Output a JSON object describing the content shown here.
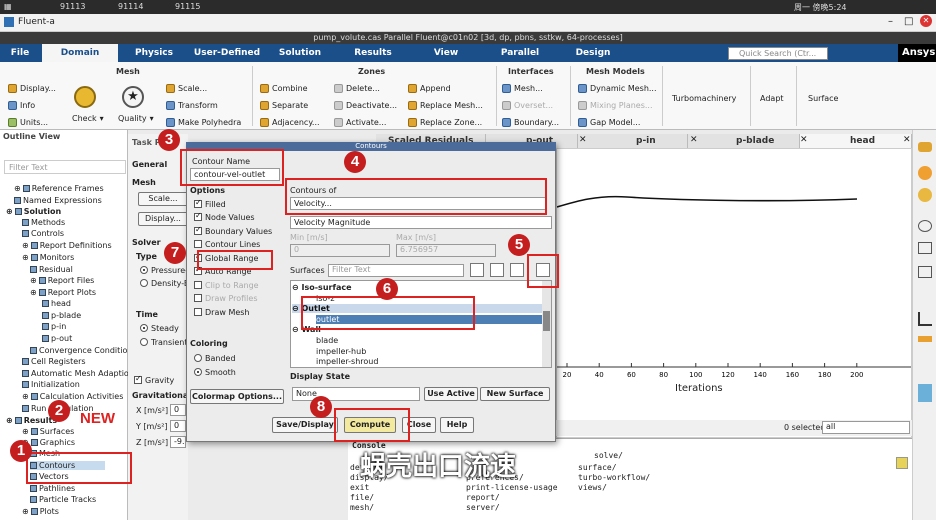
{
  "os_bar": {
    "items": [
      "91113",
      "91114",
      "91115"
    ],
    "clock": "周一 傍晚5:24"
  },
  "window": {
    "title": "Fluent-a",
    "app_title": "pump_volute.cas Parallel Fluent@c01n02  [3d, dp, pbns, sstkw, 64-processes]"
  },
  "ribbon_tabs": [
    "File",
    "Domain",
    "Physics",
    "User-Defined",
    "Solution",
    "Results",
    "View",
    "Parallel",
    "Design"
  ],
  "quick_search_placeholder": "Quick Search (Ctr...",
  "brand": "Ansys",
  "ribbon": {
    "groups": {
      "mesh": "Mesh",
      "zones": "Zones",
      "interfaces": "Interfaces",
      "mesh_models": "Mesh Models"
    },
    "mesh": {
      "display": "Display...",
      "info": "Info",
      "units": "Units...",
      "check": "Check",
      "quality": "Quality",
      "scale": "Scale...",
      "transform": "Transform",
      "polyhedra": "Make Polyhedra"
    },
    "zones": {
      "combine": "Combine",
      "separate": "Separate",
      "adjacency": "Adjacency...",
      "delete": "Delete...",
      "deactivate": "Deactivate...",
      "activate": "Activate...",
      "append": "Append",
      "replace_mesh": "Replace Mesh...",
      "replace_zone": "Replace Zone..."
    },
    "interfaces": {
      "mesh": "Mesh...",
      "overset": "Overset...",
      "boundary": "Boundary..."
    },
    "mesh_models": {
      "dynamic": "Dynamic Mesh...",
      "mixing": "Mixing Planes...",
      "gap": "Gap Model..."
    },
    "turbomachinery": "Turbomachinery",
    "adapt": "Adapt",
    "surface": "Surface"
  },
  "outline": {
    "header": "Outline View",
    "filter_placeholder": "Filter Text",
    "items": [
      "Reference Frames",
      "Named Expressions",
      "Solution",
      "Methods",
      "Controls",
      "Report Definitions",
      "Monitors",
      "Residual",
      "Report Files",
      "Report Plots",
      "head",
      "p-blade",
      "p-in",
      "p-out",
      "Convergence Conditions",
      "Cell Registers",
      "Automatic Mesh Adaption",
      "Initialization",
      "Calculation Activities",
      "Run Calculation",
      "Results",
      "Surfaces",
      "Graphics",
      "Mesh",
      "Contours",
      "Vectors",
      "Pathlines",
      "Particle Tracks",
      "Plots"
    ]
  },
  "task_page": {
    "title": "Task Page",
    "general": "General",
    "mesh": "Mesh",
    "scale": "Scale...",
    "display": "Display...",
    "solver": "Solver",
    "type": "Type",
    "pressure": "Pressure-Based",
    "density": "Density-Based",
    "time": "Time",
    "steady": "Steady",
    "transient": "Transient",
    "gravity": "Gravity",
    "gravitational": "Gravitational Acceleration",
    "x": "X [m/s²]",
    "y": "Y [m/s²]",
    "z": "Z [m/s²]",
    "x_val": "0",
    "y_val": "0",
    "z_val": "-9.81"
  },
  "graphics_tabs": [
    "Scaled Residuals",
    "p-out",
    "p-in",
    "p-blade",
    "head"
  ],
  "plot": {
    "x_ticks": [
      "20",
      "40",
      "60",
      "80",
      "100",
      "120",
      "140",
      "160",
      "180",
      "200"
    ],
    "xlabel": "Iterations"
  },
  "selection": {
    "count": "0 selected",
    "filter": "all"
  },
  "console": {
    "label": "Console",
    "lines": [
      [
        "define/",
        "",
        "surface/"
      ],
      [
        "display/",
        "preferences/",
        "turbo-workflow/"
      ],
      [
        "exit",
        "print-license-usage",
        "views/"
      ],
      [
        "file/",
        "report/",
        ""
      ],
      [
        "mesh/",
        "server/",
        ""
      ]
    ],
    "solve": "solve/"
  },
  "dialog": {
    "title": "Contours",
    "contour_name_label": "Contour Name",
    "contour_name": "contour-vel-outlet",
    "options_label": "Options",
    "options": [
      {
        "label": "Filled",
        "checked": true,
        "disabled": false
      },
      {
        "label": "Node Values",
        "checked": true,
        "disabled": false
      },
      {
        "label": "Boundary Values",
        "checked": true,
        "disabled": false
      },
      {
        "label": "Contour Lines",
        "checked": false,
        "disabled": false
      },
      {
        "label": "Global Range",
        "checked": true,
        "disabled": false
      },
      {
        "label": "Auto Range",
        "checked": true,
        "disabled": false
      },
      {
        "label": "Clip to Range",
        "checked": false,
        "disabled": true
      },
      {
        "label": "Draw Profiles",
        "checked": false,
        "disabled": true
      },
      {
        "label": "Draw Mesh",
        "checked": false,
        "disabled": false
      }
    ],
    "coloring_label": "Coloring",
    "banded": "Banded",
    "smooth": "Smooth",
    "colormap_button": "Colormap Options...",
    "contours_of_label": "Contours of",
    "contours_of": "Velocity...",
    "contours_of_sub": "Velocity Magnitude",
    "min_label": "Min [m/s]",
    "max_label": "Max [m/s]",
    "min_val": "0",
    "max_val": "6.756957",
    "surfaces_label": "Surfaces",
    "surfaces_filter_placeholder": "Filter Text",
    "surface_list": [
      "Iso-surface",
      "iso-z",
      "Outlet",
      "outlet",
      "Wall",
      "blade",
      "impeller-hub",
      "impeller-shroud"
    ],
    "display_state_label": "Display State",
    "display_state": "None",
    "use_active": "Use Active",
    "new_surface": "New Surface",
    "buttons": {
      "save": "Save/Display",
      "compute": "Compute",
      "close": "Close",
      "help": "Help"
    }
  },
  "annotations": {
    "badges": [
      "1",
      "2",
      "3",
      "4",
      "5",
      "6",
      "7",
      "8"
    ],
    "new_label": "NEW",
    "subtitle": "蜗壳出口流速",
    "accent": "#d22222"
  }
}
